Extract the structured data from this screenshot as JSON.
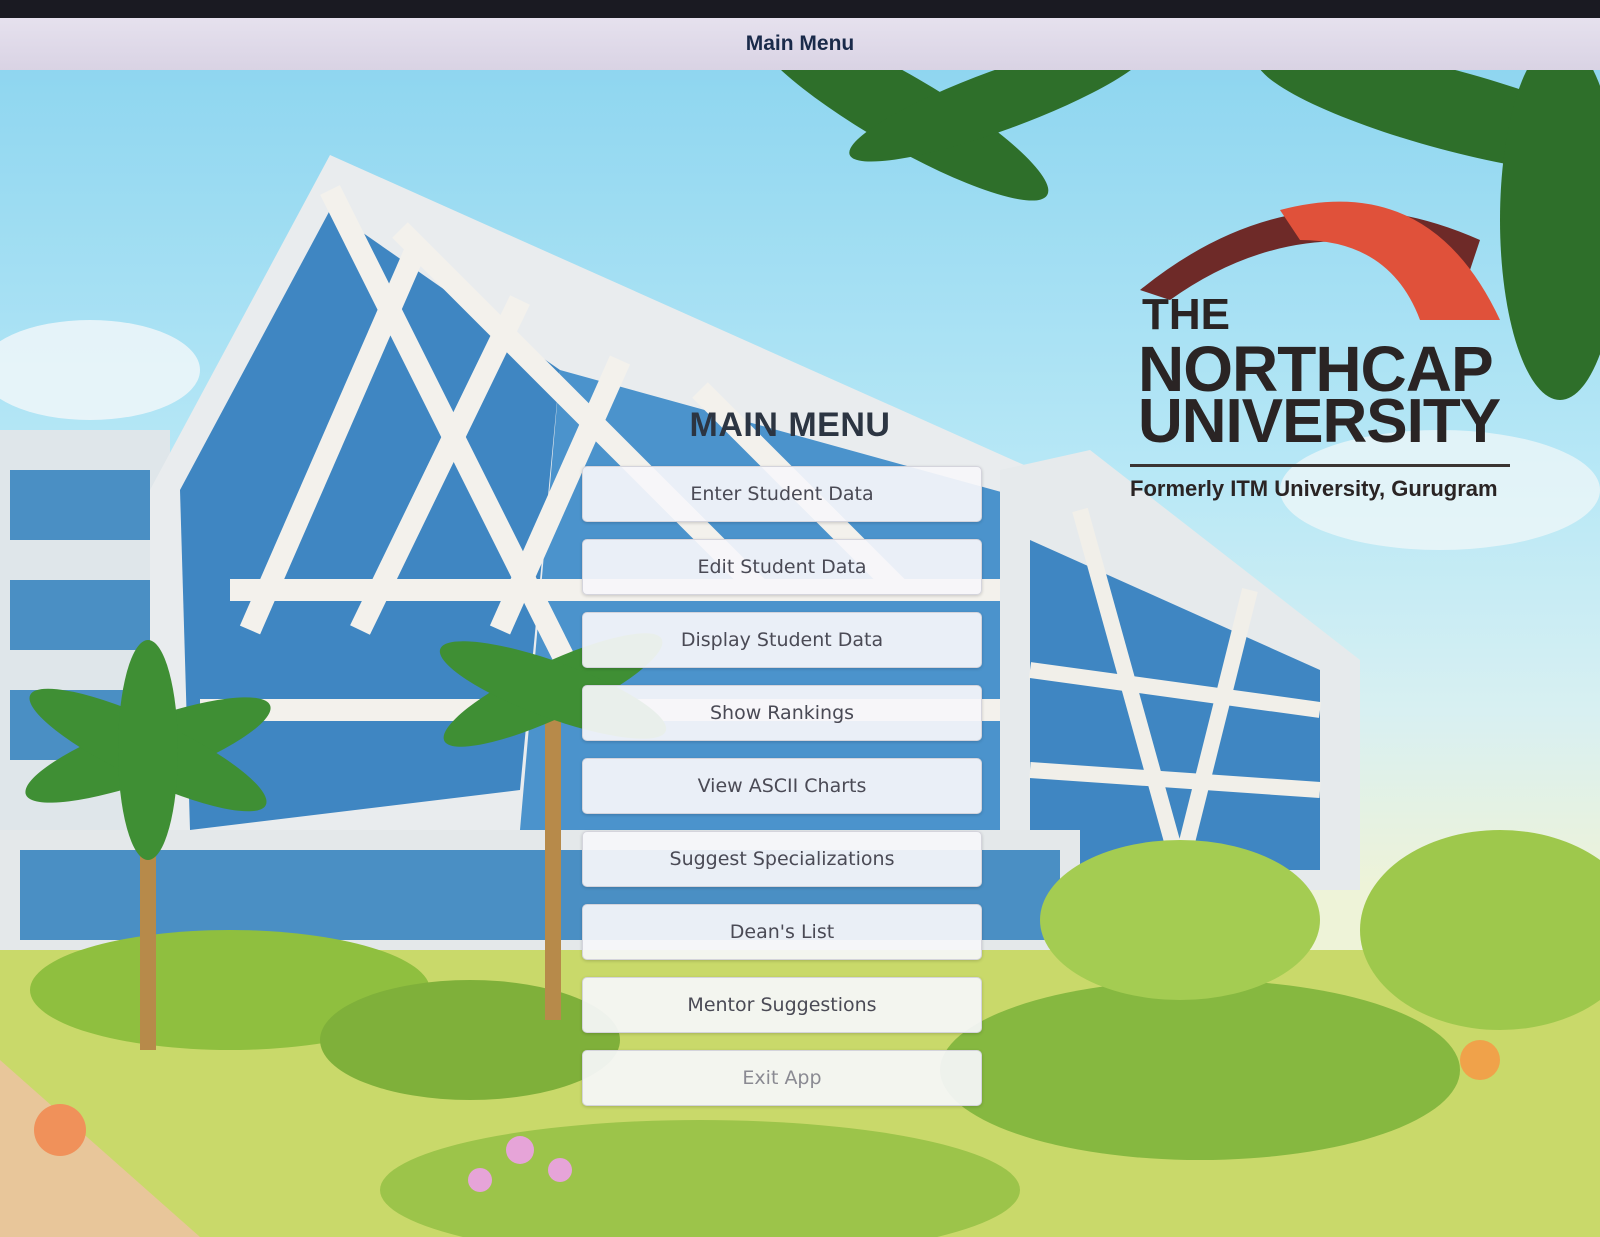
{
  "window": {
    "title": "Main Menu"
  },
  "menu": {
    "heading": "MAIN MENU",
    "buttons": [
      {
        "label": "Enter Student Data"
      },
      {
        "label": "Edit Student Data"
      },
      {
        "label": "Display Student Data"
      },
      {
        "label": "Show Rankings"
      },
      {
        "label": "View ASCII Charts"
      },
      {
        "label": "Suggest Specializations"
      },
      {
        "label": "Dean's List"
      },
      {
        "label": "Mentor Suggestions"
      },
      {
        "label": "Exit App"
      }
    ]
  },
  "logo": {
    "line1": "THE",
    "line2": "NORTHCAP",
    "line3": "UNIVERSITY",
    "tagline": "Formerly ITM University, Gurugram",
    "arc_colors": {
      "dark": "#6e2a28",
      "light": "#e0513a"
    }
  },
  "background": {
    "description_icon": "campus-building-illustration"
  }
}
